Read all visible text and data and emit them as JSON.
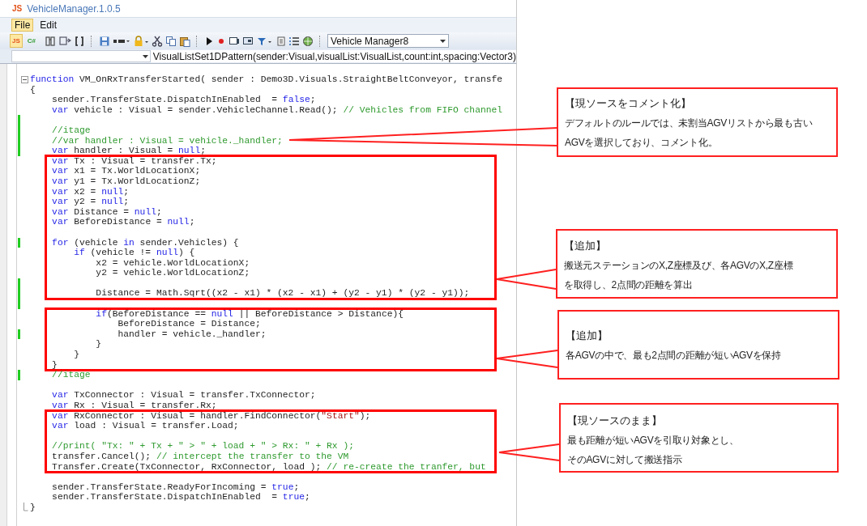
{
  "window": {
    "logo": "JS",
    "title": "VehicleManager.1.0.5"
  },
  "menu": [
    {
      "label": "File",
      "selected": true
    },
    {
      "label": "Edit",
      "selected": false
    }
  ],
  "toolbar": {
    "buttons": [
      {
        "label": "JS",
        "selected": true
      },
      {
        "label": "C#",
        "selected": false
      }
    ],
    "combo": "Vehicle Manager8"
  },
  "member_bar": {
    "member": "VisualListSet1DPattern(sender:Visual,visualList:VisualList,count:int,spacing:Vector3)"
  },
  "editor": {
    "blocks": [
      {
        "highlighted": false,
        "lines": [
          {
            "modified": false,
            "collapsible": true,
            "tokens": [
              {
                "kind": "keyword",
                "text": "function"
              },
              {
                "kind": "plain",
                "text": " VM_OnRxTransferStarted( sender : Demo3D.Visuals.StraightBeltConveyor, transfe"
              }
            ]
          },
          {
            "modified": false,
            "tokens": [
              {
                "kind": "plain",
                "text": "{"
              }
            ]
          },
          {
            "modified": false,
            "tokens": [
              {
                "kind": "plain",
                "text": "    sender.TransferState.DispatchInEnabled  = "
              },
              {
                "kind": "keyword",
                "text": "false"
              },
              {
                "kind": "plain",
                "text": ";"
              }
            ]
          },
          {
            "modified": false,
            "tokens": [
              {
                "kind": "keyword",
                "text": "    var"
              },
              {
                "kind": "plain",
                "text": " vehicle : Visual = sender.VehicleChannel.Read(); "
              },
              {
                "kind": "comment",
                "text": "// Vehicles from FIFO channel"
              }
            ]
          },
          {
            "modified": true
          },
          {
            "modified": true,
            "tokens": [
              {
                "kind": "comment",
                "text": "    //itage"
              }
            ]
          },
          {
            "modified": true,
            "tokens": [
              {
                "kind": "comment",
                "text": "    //var handler : Visual = vehicle._handler;"
              }
            ]
          },
          {
            "modified": true,
            "tokens": [
              {
                "kind": "keyword",
                "text": "    var"
              },
              {
                "kind": "plain",
                "text": " handler : Visual = "
              },
              {
                "kind": "keyword",
                "text": "null"
              },
              {
                "kind": "plain",
                "text": ";"
              }
            ]
          }
        ]
      },
      {
        "highlighted": true,
        "lines": [
          {
            "modified": false,
            "tokens": [
              {
                "kind": "keyword",
                "text": "    var"
              },
              {
                "kind": "plain",
                "text": " Tx : Visual = transfer.Tx;"
              }
            ]
          },
          {
            "modified": false,
            "tokens": [
              {
                "kind": "keyword",
                "text": "    var"
              },
              {
                "kind": "plain",
                "text": " x1 = Tx.WorldLocationX;"
              }
            ]
          },
          {
            "modified": false,
            "tokens": [
              {
                "kind": "keyword",
                "text": "    var"
              },
              {
                "kind": "plain",
                "text": " y1 = Tx.WorldLocationZ;"
              }
            ]
          },
          {
            "modified": false,
            "tokens": [
              {
                "kind": "keyword",
                "text": "    var"
              },
              {
                "kind": "plain",
                "text": " x2 = "
              },
              {
                "kind": "keyword",
                "text": "null"
              },
              {
                "kind": "plain",
                "text": ";"
              }
            ]
          },
          {
            "modified": false,
            "tokens": [
              {
                "kind": "keyword",
                "text": "    var"
              },
              {
                "kind": "plain",
                "text": " y2 = "
              },
              {
                "kind": "keyword",
                "text": "null"
              },
              {
                "kind": "plain",
                "text": ";"
              }
            ]
          },
          {
            "modified": false,
            "tokens": [
              {
                "kind": "keyword",
                "text": "    var"
              },
              {
                "kind": "plain",
                "text": " Distance = "
              },
              {
                "kind": "keyword",
                "text": "null"
              },
              {
                "kind": "plain",
                "text": ";"
              }
            ]
          },
          {
            "modified": false,
            "tokens": [
              {
                "kind": "keyword",
                "text": "    var"
              },
              {
                "kind": "plain",
                "text": " BeforeDistance = "
              },
              {
                "kind": "keyword",
                "text": "null"
              },
              {
                "kind": "plain",
                "text": ";"
              }
            ]
          },
          {
            "modified": false
          },
          {
            "modified": true,
            "tokens": [
              {
                "kind": "keyword",
                "text": "    for"
              },
              {
                "kind": "plain",
                "text": " (vehicle "
              },
              {
                "kind": "keyword",
                "text": "in"
              },
              {
                "kind": "plain",
                "text": " sender.Vehicles) {"
              }
            ]
          },
          {
            "modified": false,
            "tokens": [
              {
                "kind": "keyword",
                "text": "        if"
              },
              {
                "kind": "plain",
                "text": " (vehicle != "
              },
              {
                "kind": "keyword",
                "text": "null"
              },
              {
                "kind": "plain",
                "text": ") {"
              }
            ]
          },
          {
            "modified": false,
            "tokens": [
              {
                "kind": "plain",
                "text": "            x2 = vehicle.WorldLocationX;"
              }
            ]
          },
          {
            "modified": false,
            "tokens": [
              {
                "kind": "plain",
                "text": "            y2 = vehicle.WorldLocationZ;"
              }
            ]
          },
          {
            "modified": true
          },
          {
            "modified": true,
            "tokens": [
              {
                "kind": "plain",
                "text": "            Distance = Math.Sqrt((x2 - x1) * (x2 - x1) + (y2 - y1) * (y2 - y1));"
              }
            ]
          }
        ]
      },
      {
        "highlighted": false,
        "lines": [
          {
            "modified": true
          }
        ]
      },
      {
        "highlighted": true,
        "lines": [
          {
            "modified": false,
            "tokens": [
              {
                "kind": "keyword",
                "text": "            if"
              },
              {
                "kind": "plain",
                "text": "(BeforeDistance == "
              },
              {
                "kind": "keyword",
                "text": "null"
              },
              {
                "kind": "plain",
                "text": " || BeforeDistance > Distance){"
              }
            ]
          },
          {
            "modified": false,
            "tokens": [
              {
                "kind": "plain",
                "text": "                BeforeDistance = Distance;"
              }
            ]
          },
          {
            "modified": true,
            "tokens": [
              {
                "kind": "plain",
                "text": "                handler = vehicle._handler;"
              }
            ]
          },
          {
            "modified": false,
            "tokens": [
              {
                "kind": "plain",
                "text": "            }"
              }
            ]
          },
          {
            "modified": false,
            "tokens": [
              {
                "kind": "plain",
                "text": "        }"
              }
            ]
          },
          {
            "modified": false,
            "tokens": [
              {
                "kind": "plain",
                "text": "    }"
              }
            ]
          }
        ]
      },
      {
        "highlighted": false,
        "lines": [
          {
            "modified": true,
            "tokens": [
              {
                "kind": "comment",
                "text": "    //itage"
              }
            ]
          },
          {
            "modified": false
          },
          {
            "modified": false,
            "tokens": [
              {
                "kind": "keyword",
                "text": "    var"
              },
              {
                "kind": "plain",
                "text": " TxConnector : Visual = transfer.TxConnector;"
              }
            ]
          },
          {
            "modified": false,
            "tokens": [
              {
                "kind": "keyword",
                "text": "    var"
              },
              {
                "kind": "plain",
                "text": " Rx : Visual = transfer.Rx;"
              }
            ]
          }
        ]
      },
      {
        "highlighted": true,
        "lines": [
          {
            "modified": false,
            "tokens": [
              {
                "kind": "keyword",
                "text": "    var"
              },
              {
                "kind": "plain",
                "text": " RxConnector : Visual = handler.FindConnector("
              },
              {
                "kind": "string",
                "text": "\"Start\""
              },
              {
                "kind": "plain",
                "text": ");"
              }
            ]
          },
          {
            "modified": false,
            "tokens": [
              {
                "kind": "keyword",
                "text": "    var"
              },
              {
                "kind": "plain",
                "text": " load : Visual = transfer.Load;"
              }
            ]
          },
          {
            "modified": false
          },
          {
            "modified": false,
            "tokens": [
              {
                "kind": "comment",
                "text": "    //print( \"Tx: \" + Tx + \" > \" + load + \" > Rx: \" + Rx );"
              }
            ]
          },
          {
            "modified": false,
            "tokens": [
              {
                "kind": "plain",
                "text": "    transfer.Cancel(); "
              },
              {
                "kind": "comment",
                "text": "// intercept the transfer to the VM"
              }
            ]
          },
          {
            "modified": false,
            "tokens": [
              {
                "kind": "plain",
                "text": "    Transfer.Create(TxConnector, RxConnector, load ); "
              },
              {
                "kind": "comment",
                "text": "// re-create the tranfer, but"
              }
            ]
          }
        ]
      },
      {
        "highlighted": false,
        "lines": [
          {
            "modified": false
          },
          {
            "modified": false,
            "tokens": [
              {
                "kind": "plain",
                "text": "    sender.TransferState.ReadyForIncoming = "
              },
              {
                "kind": "keyword",
                "text": "true"
              },
              {
                "kind": "plain",
                "text": ";"
              }
            ]
          },
          {
            "modified": false,
            "tokens": [
              {
                "kind": "plain",
                "text": "    sender.TransferState.DispatchInEnabled  = "
              },
              {
                "kind": "keyword",
                "text": "true"
              },
              {
                "kind": "plain",
                "text": ";"
              }
            ]
          },
          {
            "modified": false,
            "fold_end": true,
            "tokens": [
              {
                "kind": "plain",
                "text": "}"
              }
            ]
          }
        ]
      }
    ]
  },
  "annotations": [
    {
      "title": "【現ソースをコメント化】",
      "lines": [
        "デフォルトのルールでは、未割当AGVリストから最も古い",
        "AGVを選択しており、コメント化。"
      ]
    },
    {
      "title": "【追加】",
      "lines": [
        "搬送元ステーションのX,Z座標及び、各AGVのX,Z座標",
        "を取得し、2点間の距離を算出"
      ]
    },
    {
      "title": "【追加】",
      "lines": [
        "各AGVの中で、最も2点間の距離が短いAGVを保持"
      ]
    },
    {
      "title": "【現ソースのまま】",
      "lines": [
        "最も距離が短いAGVを引取り対象とし、",
        "そのAGVに対して搬送指示"
      ]
    }
  ]
}
